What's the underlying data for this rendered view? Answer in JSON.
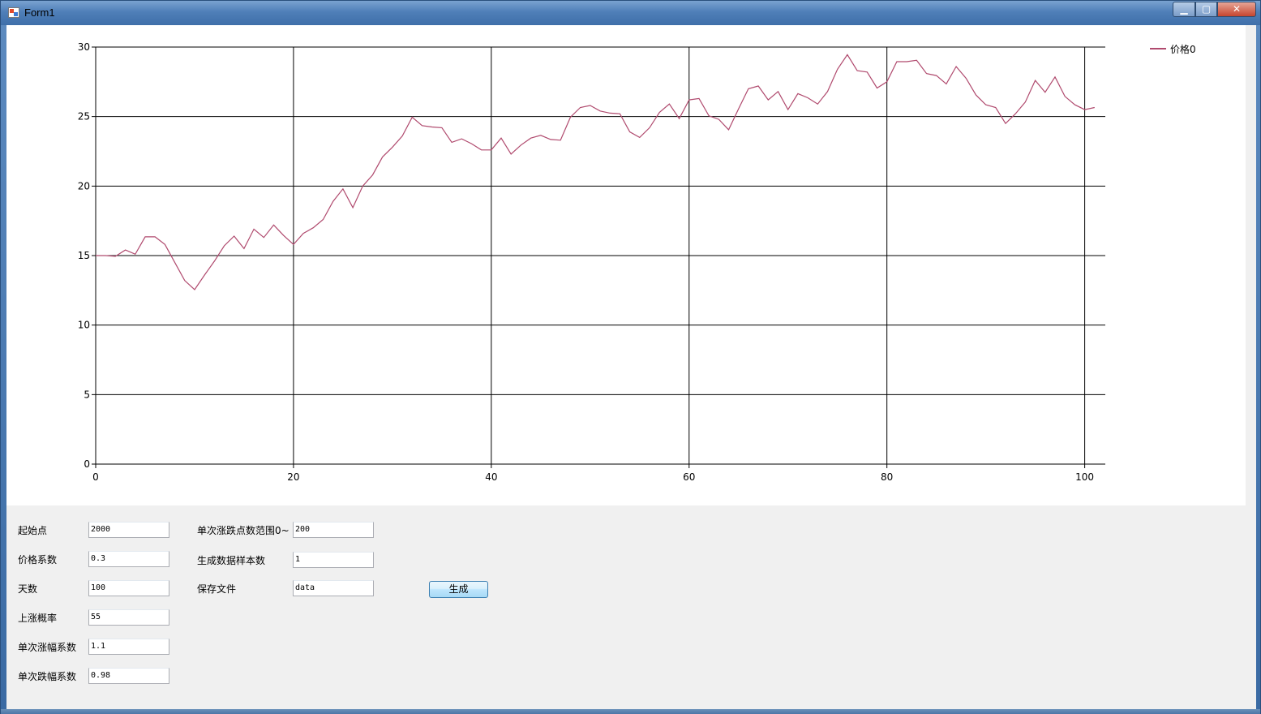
{
  "window": {
    "title": "Form1",
    "controls": {
      "minimize": "▁",
      "maximize": "▢",
      "close": "✕"
    }
  },
  "form": {
    "labels": {
      "start_point": "起始点",
      "price_coef": "价格系数",
      "days": "天数",
      "up_prob": "上涨概率",
      "up_coef": "单次涨幅系数",
      "down_coef": "单次跌幅系数",
      "range": "单次涨跌点数范围0~",
      "samples": "生成数据样本数",
      "save_file": "保存文件"
    },
    "values": {
      "start_point": "2000",
      "price_coef": "0.3",
      "days": "100",
      "up_prob": "55",
      "up_coef": "1.1",
      "down_coef": "0.98",
      "range": "200",
      "samples": "1",
      "save_file": "data"
    },
    "generate_label": "生成"
  },
  "chart_data": {
    "type": "line",
    "xlim": [
      0,
      100
    ],
    "ylim": [
      0,
      30
    ],
    "x_ticks": [
      0,
      20,
      40,
      60,
      80,
      100
    ],
    "y_ticks": [
      0,
      5,
      10,
      15,
      20,
      25,
      30
    ],
    "grid": true,
    "legend_position": "top-right",
    "series_color": "#b04a6e",
    "series": [
      {
        "name": "价格0",
        "x": [
          0,
          1,
          2,
          3,
          4,
          5,
          6,
          7,
          8,
          9,
          10,
          11,
          12,
          13,
          14,
          15,
          16,
          17,
          18,
          19,
          20,
          21,
          22,
          23,
          24,
          25,
          26,
          27,
          28,
          29,
          30,
          31,
          32,
          33,
          34,
          35,
          36,
          37,
          38,
          39,
          40,
          41,
          42,
          43,
          44,
          45,
          46,
          47,
          48,
          49,
          50,
          51,
          52,
          53,
          54,
          55,
          56,
          57,
          58,
          59,
          60,
          61,
          62,
          63,
          64,
          65,
          66,
          67,
          68,
          69,
          70,
          71,
          72,
          73,
          74,
          75,
          76,
          77,
          78,
          79,
          80,
          81,
          82,
          83,
          84,
          85,
          86,
          87,
          88,
          89,
          90,
          91,
          92,
          93,
          94,
          95,
          96,
          97,
          98,
          99,
          100,
          101
        ],
        "values": [
          15.0,
          15.0,
          14.95,
          15.4,
          15.1,
          16.35,
          16.35,
          15.8,
          14.5,
          13.2,
          12.55,
          13.6,
          14.6,
          15.7,
          16.4,
          15.5,
          16.9,
          16.3,
          17.2,
          16.45,
          15.8,
          16.6,
          17.0,
          17.6,
          18.9,
          19.8,
          18.45,
          20.0,
          20.8,
          22.1,
          22.8,
          23.6,
          24.95,
          24.35,
          24.25,
          24.2,
          23.15,
          23.4,
          23.05,
          22.6,
          22.6,
          23.45,
          22.3,
          22.95,
          23.45,
          23.65,
          23.35,
          23.3,
          24.95,
          25.65,
          25.8,
          25.4,
          25.25,
          25.2,
          23.9,
          23.5,
          24.2,
          25.3,
          25.9,
          24.85,
          26.2,
          26.3,
          25.05,
          24.8,
          24.05,
          25.55,
          27.0,
          27.2,
          26.2,
          26.8,
          25.5,
          26.65,
          26.35,
          25.9,
          26.8,
          28.4,
          29.45,
          28.3,
          28.2,
          27.05,
          27.5,
          28.95,
          28.95,
          29.05,
          28.1,
          27.95,
          27.35,
          28.6,
          27.75,
          26.55,
          25.85,
          25.65,
          24.5,
          25.2,
          26.05,
          27.6,
          26.75,
          27.85,
          26.45,
          25.85,
          25.5,
          25.65
        ]
      }
    ]
  }
}
